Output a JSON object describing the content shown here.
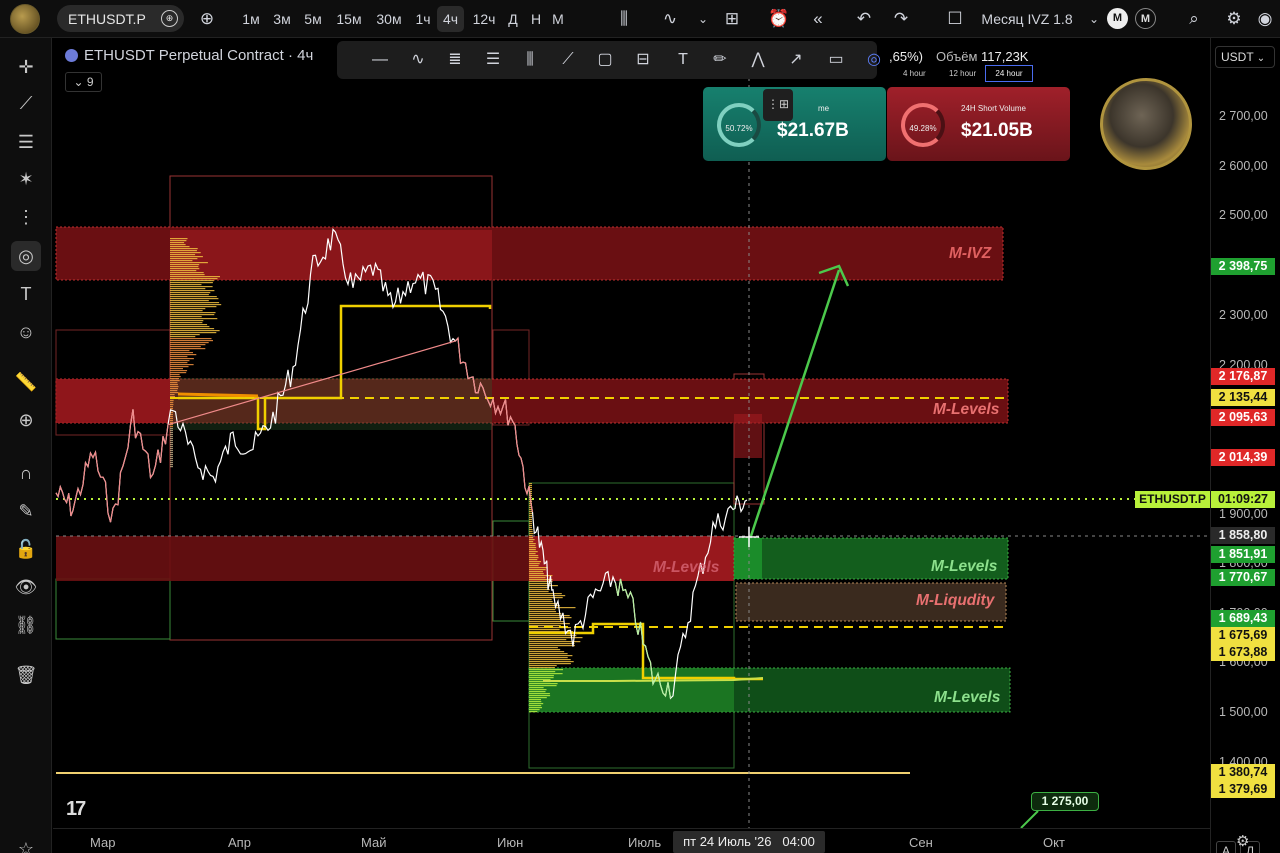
{
  "topbar": {
    "symbol": "ETHUSDT.P",
    "timeframes": [
      "1м",
      "3м",
      "5м",
      "15м",
      "30м",
      "1ч",
      "4ч",
      "12ч",
      "Д",
      "Н",
      "М"
    ],
    "active_timeframe": "4ч",
    "layout_name": "Месяц IVZ 1.8",
    "avatar_left": "M",
    "avatar_right": "M"
  },
  "legend": {
    "title": "ETHUSDT Perpetual Contract · 4ч",
    "indicators_count": "9"
  },
  "volume_widget": {
    "change": ",65%)",
    "volume_label": "Объём",
    "volume_value": "117,23K",
    "periods": [
      "4 hour",
      "12 hour",
      "24 hour"
    ],
    "active_period": "24 hour"
  },
  "cards": {
    "long": {
      "title": "me",
      "percent": "50.72%",
      "value": "$21.67B"
    },
    "short": {
      "title": "24H Short Volume",
      "percent": "49.28%",
      "value": "$21.05B"
    }
  },
  "price_axis": {
    "currency": "USDT",
    "ticks": [
      "2 700,00",
      "2 600,00",
      "2 500,00",
      "2 300,00",
      "2 200,00",
      "1 900,00",
      "1 800,00",
      "1 700,00",
      "1 600,00",
      "1 500,00",
      "1 400,00"
    ],
    "labels": {
      "l2398": "2 398,75",
      "l2176": "2 176,87",
      "l2135": "2 135,44",
      "l2095": "2 095,63",
      "l2014": "2 014,39",
      "last_countdown": "01:09:27",
      "cursor": "1 858,80",
      "l1851": "1 851,91",
      "l1770": "1 770,67",
      "l1689": "1 689,43",
      "l1675": "1 675,69",
      "l1673": "1 673,88",
      "l1380": "1 380,74",
      "l1379": "1 379,69"
    },
    "last_symbol": "ETHUSDT.P"
  },
  "time_axis": {
    "months": [
      "Мар",
      "Апр",
      "Май",
      "Июн",
      "Июль",
      "Сен",
      "Окт"
    ],
    "cursor_date": "пт 24 Июль '26",
    "cursor_time": "04:00"
  },
  "zones": {
    "ivz": "M-IVZ",
    "levels_top": "M-Levels",
    "levels_mid": "M-Levels",
    "levels_mid_faded": "M-Levels",
    "liquidity": "M-Liqudity",
    "levels_bottom": "M-Levels"
  },
  "target": "1 275,00",
  "bottom_right": {
    "auto": "A",
    "log": "Л"
  },
  "colors": {
    "red_zone": "#8b1a1a",
    "green_zone": "#1e7a2a",
    "poc_yellow": "#f0d000",
    "arrow_green": "#4cc94c",
    "last_price": "#b8f03a"
  }
}
